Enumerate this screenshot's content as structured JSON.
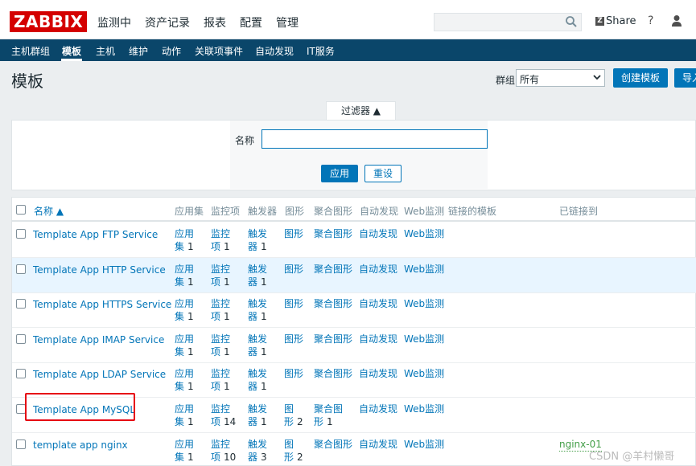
{
  "header": {
    "logo": "ZABBIX",
    "menu": [
      "监测中",
      "资产记录",
      "报表",
      "配置",
      "管理"
    ],
    "share_label": "Share",
    "help_label": "?"
  },
  "subnav": {
    "items": [
      "主机群组",
      "模板",
      "主机",
      "维护",
      "动作",
      "关联项事件",
      "自动发现",
      "IT服务"
    ],
    "active": "模板"
  },
  "page": {
    "title": "模板",
    "group_label": "群组",
    "group_value": "所有",
    "create_button": "创建模板",
    "import_button": "导入"
  },
  "filter": {
    "tab_label": "过滤器 ▲",
    "name_label": "名称",
    "name_value": "",
    "apply_label": "应用",
    "reset_label": "重设"
  },
  "table": {
    "headers": [
      "名称 ▲",
      "应用集",
      "监控项",
      "触发器",
      "图形",
      "聚合图形",
      "自动发现",
      "Web监测",
      "链接的模板",
      "已链接到"
    ],
    "rows": [
      {
        "name": "Template App FTP Service",
        "app_a": "应用",
        "app_b": "集",
        "app_n": "1",
        "item_a": "监控",
        "item_b": "项",
        "item_n": "1",
        "trig_a": "触发",
        "trig_b": "器",
        "trig_n": "1",
        "graph_a": "图形",
        "graph_b": "",
        "graph_n": "",
        "screen_a": "聚合图形",
        "screen_b": "",
        "screen_n": "",
        "disc": "自动发现",
        "web": "Web监测",
        "linked": ""
      },
      {
        "name": "Template App HTTP Service",
        "app_a": "应用",
        "app_b": "集",
        "app_n": "1",
        "item_a": "监控",
        "item_b": "项",
        "item_n": "1",
        "trig_a": "触发",
        "trig_b": "器",
        "trig_n": "1",
        "graph_a": "图形",
        "graph_b": "",
        "graph_n": "",
        "screen_a": "聚合图形",
        "screen_b": "",
        "screen_n": "",
        "disc": "自动发现",
        "web": "Web监测",
        "linked": ""
      },
      {
        "name": "Template App HTTPS Service",
        "app_a": "应用",
        "app_b": "集",
        "app_n": "1",
        "item_a": "监控",
        "item_b": "项",
        "item_n": "1",
        "trig_a": "触发",
        "trig_b": "器",
        "trig_n": "1",
        "graph_a": "图形",
        "graph_b": "",
        "graph_n": "",
        "screen_a": "聚合图形",
        "screen_b": "",
        "screen_n": "",
        "disc": "自动发现",
        "web": "Web监测",
        "linked": ""
      },
      {
        "name": "Template App IMAP Service",
        "app_a": "应用",
        "app_b": "集",
        "app_n": "1",
        "item_a": "监控",
        "item_b": "项",
        "item_n": "1",
        "trig_a": "触发",
        "trig_b": "器",
        "trig_n": "1",
        "graph_a": "图形",
        "graph_b": "",
        "graph_n": "",
        "screen_a": "聚合图形",
        "screen_b": "",
        "screen_n": "",
        "disc": "自动发现",
        "web": "Web监测",
        "linked": ""
      },
      {
        "name": "Template App LDAP Service",
        "app_a": "应用",
        "app_b": "集",
        "app_n": "1",
        "item_a": "监控",
        "item_b": "项",
        "item_n": "1",
        "trig_a": "触发",
        "trig_b": "器",
        "trig_n": "1",
        "graph_a": "图形",
        "graph_b": "",
        "graph_n": "",
        "screen_a": "聚合图形",
        "screen_b": "",
        "screen_n": "",
        "disc": "自动发现",
        "web": "Web监测",
        "linked": ""
      },
      {
        "name": "Template App MySQL",
        "app_a": "应用",
        "app_b": "集",
        "app_n": "1",
        "item_a": "监控",
        "item_b": "项",
        "item_n": "14",
        "trig_a": "触发",
        "trig_b": "器",
        "trig_n": "1",
        "graph_a": "图",
        "graph_b": "形",
        "graph_n": "2",
        "screen_a": "聚合图",
        "screen_b": "形",
        "screen_n": "1",
        "disc": "自动发现",
        "web": "Web监测",
        "linked": ""
      },
      {
        "name": "template app nginx",
        "app_a": "应用",
        "app_b": "集",
        "app_n": "1",
        "item_a": "监控",
        "item_b": "项",
        "item_n": "10",
        "trig_a": "触发",
        "trig_b": "器",
        "trig_n": "3",
        "graph_a": "图",
        "graph_b": "形",
        "graph_n": "2",
        "screen_a": "聚合图形",
        "screen_b": "",
        "screen_n": "",
        "disc": "自动发现",
        "web": "Web监测",
        "linked": "nginx-01"
      }
    ]
  },
  "watermark": "CSDN @羊村懒哥",
  "colors": {
    "accent": "#0275b8",
    "nav": "#0a466a",
    "logo": "#d40000",
    "highlight": "#e60012",
    "linked": "#429e47"
  }
}
